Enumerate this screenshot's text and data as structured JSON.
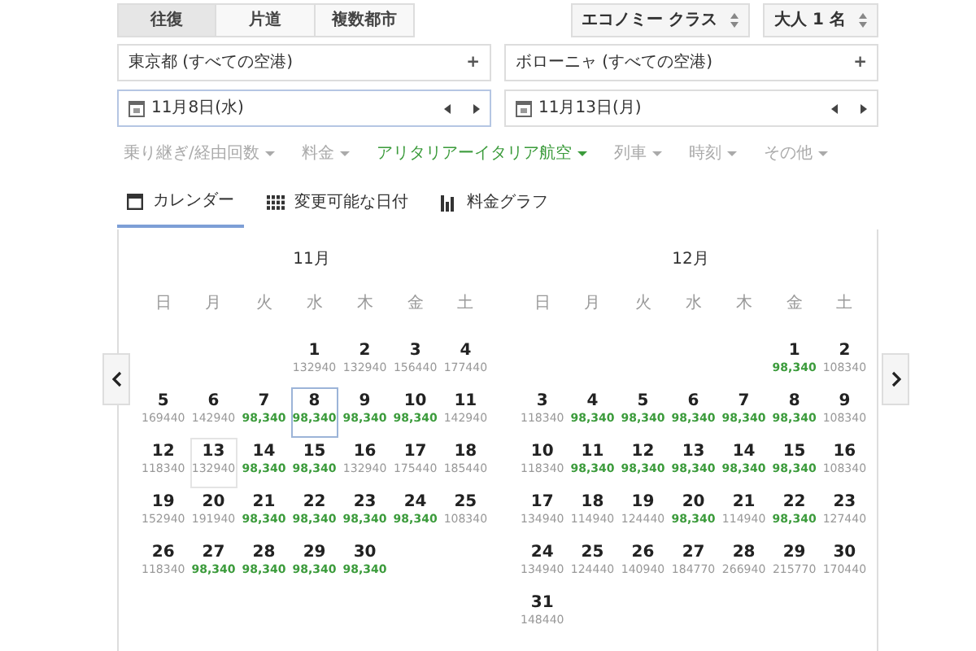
{
  "trip_types": [
    {
      "label": "往復",
      "selected": true
    },
    {
      "label": "片道",
      "selected": false
    },
    {
      "label": "複数都市",
      "selected": false
    }
  ],
  "cabin_select": {
    "value": "エコノミー クラス"
  },
  "passengers_select": {
    "value": "大人 1 名"
  },
  "origin": {
    "value": "東京都 (すべての空港)",
    "action": "+"
  },
  "destination": {
    "value": "ボローニャ (すべての空港)",
    "action": "+"
  },
  "departure_date": {
    "value": "11月8日(水)"
  },
  "return_date": {
    "value": "11月13日(月)"
  },
  "filters": [
    {
      "label": "乗り継ぎ/経由回数",
      "active": false
    },
    {
      "label": "料金",
      "active": false
    },
    {
      "label": "アリタリアーイタリア航空",
      "active": true
    },
    {
      "label": "列車",
      "active": false
    },
    {
      "label": "時刻",
      "active": false
    },
    {
      "label": "その他",
      "active": false
    }
  ],
  "view_tabs": [
    {
      "label": "カレンダー",
      "kind": "calendar",
      "selected": true
    },
    {
      "label": "変更可能な日付",
      "kind": "grid",
      "selected": false
    },
    {
      "label": "料金グラフ",
      "kind": "chart",
      "selected": false
    }
  ],
  "months": [
    {
      "title": "11月",
      "weekdays": [
        "日",
        "月",
        "火",
        "水",
        "木",
        "金",
        "土"
      ],
      "weeks": [
        [
          {
            "kind": "blank"
          },
          {
            "kind": "blank"
          },
          {
            "kind": "blank"
          },
          {
            "kind": "day",
            "day": "1",
            "price": "132940",
            "cheapest": false,
            "selected": false,
            "return_selected": false
          },
          {
            "kind": "day",
            "day": "2",
            "price": "132940",
            "cheapest": false,
            "selected": false,
            "return_selected": false
          },
          {
            "kind": "day",
            "day": "3",
            "price": "156440",
            "cheapest": false,
            "selected": false,
            "return_selected": false
          },
          {
            "kind": "day",
            "day": "4",
            "price": "177440",
            "cheapest": false,
            "selected": false,
            "return_selected": false
          }
        ],
        [
          {
            "kind": "day",
            "day": "5",
            "price": "169440",
            "cheapest": false,
            "selected": false,
            "return_selected": false
          },
          {
            "kind": "day",
            "day": "6",
            "price": "142940",
            "cheapest": false,
            "selected": false,
            "return_selected": false
          },
          {
            "kind": "day",
            "day": "7",
            "price": "98,340",
            "cheapest": true,
            "selected": false,
            "return_selected": false
          },
          {
            "kind": "day",
            "day": "8",
            "price": "98,340",
            "cheapest": true,
            "selected": true,
            "return_selected": false
          },
          {
            "kind": "day",
            "day": "9",
            "price": "98,340",
            "cheapest": true,
            "selected": false,
            "return_selected": false
          },
          {
            "kind": "day",
            "day": "10",
            "price": "98,340",
            "cheapest": true,
            "selected": false,
            "return_selected": false
          },
          {
            "kind": "day",
            "day": "11",
            "price": "142940",
            "cheapest": false,
            "selected": false,
            "return_selected": false
          }
        ],
        [
          {
            "kind": "day",
            "day": "12",
            "price": "118340",
            "cheapest": false,
            "selected": false,
            "return_selected": false
          },
          {
            "kind": "day",
            "day": "13",
            "price": "132940",
            "cheapest": false,
            "selected": false,
            "return_selected": true
          },
          {
            "kind": "day",
            "day": "14",
            "price": "98,340",
            "cheapest": true,
            "selected": false,
            "return_selected": false
          },
          {
            "kind": "day",
            "day": "15",
            "price": "98,340",
            "cheapest": true,
            "selected": false,
            "return_selected": false
          },
          {
            "kind": "day",
            "day": "16",
            "price": "132940",
            "cheapest": false,
            "selected": false,
            "return_selected": false
          },
          {
            "kind": "day",
            "day": "17",
            "price": "175440",
            "cheapest": false,
            "selected": false,
            "return_selected": false
          },
          {
            "kind": "day",
            "day": "18",
            "price": "185440",
            "cheapest": false,
            "selected": false,
            "return_selected": false
          }
        ],
        [
          {
            "kind": "day",
            "day": "19",
            "price": "152940",
            "cheapest": false,
            "selected": false,
            "return_selected": false
          },
          {
            "kind": "day",
            "day": "20",
            "price": "191940",
            "cheapest": false,
            "selected": false,
            "return_selected": false
          },
          {
            "kind": "day",
            "day": "21",
            "price": "98,340",
            "cheapest": true,
            "selected": false,
            "return_selected": false
          },
          {
            "kind": "day",
            "day": "22",
            "price": "98,340",
            "cheapest": true,
            "selected": false,
            "return_selected": false
          },
          {
            "kind": "day",
            "day": "23",
            "price": "98,340",
            "cheapest": true,
            "selected": false,
            "return_selected": false
          },
          {
            "kind": "day",
            "day": "24",
            "price": "98,340",
            "cheapest": true,
            "selected": false,
            "return_selected": false
          },
          {
            "kind": "day",
            "day": "25",
            "price": "108340",
            "cheapest": false,
            "selected": false,
            "return_selected": false
          }
        ],
        [
          {
            "kind": "day",
            "day": "26",
            "price": "118340",
            "cheapest": false,
            "selected": false,
            "return_selected": false
          },
          {
            "kind": "day",
            "day": "27",
            "price": "98,340",
            "cheapest": true,
            "selected": false,
            "return_selected": false
          },
          {
            "kind": "day",
            "day": "28",
            "price": "98,340",
            "cheapest": true,
            "selected": false,
            "return_selected": false
          },
          {
            "kind": "day",
            "day": "29",
            "price": "98,340",
            "cheapest": true,
            "selected": false,
            "return_selected": false
          },
          {
            "kind": "day",
            "day": "30",
            "price": "98,340",
            "cheapest": true,
            "selected": false,
            "return_selected": false
          }
        ]
      ]
    },
    {
      "title": "12月",
      "weekdays": [
        "日",
        "月",
        "火",
        "水",
        "木",
        "金",
        "土"
      ],
      "weeks": [
        [
          {
            "kind": "blank"
          },
          {
            "kind": "blank"
          },
          {
            "kind": "blank"
          },
          {
            "kind": "blank"
          },
          {
            "kind": "blank"
          },
          {
            "kind": "day",
            "day": "1",
            "price": "98,340",
            "cheapest": true,
            "selected": false,
            "return_selected": false
          },
          {
            "kind": "day",
            "day": "2",
            "price": "108340",
            "cheapest": false,
            "selected": false,
            "return_selected": false
          }
        ],
        [
          {
            "kind": "day",
            "day": "3",
            "price": "118340",
            "cheapest": false,
            "selected": false,
            "return_selected": false
          },
          {
            "kind": "day",
            "day": "4",
            "price": "98,340",
            "cheapest": true,
            "selected": false,
            "return_selected": false
          },
          {
            "kind": "day",
            "day": "5",
            "price": "98,340",
            "cheapest": true,
            "selected": false,
            "return_selected": false
          },
          {
            "kind": "day",
            "day": "6",
            "price": "98,340",
            "cheapest": true,
            "selected": false,
            "return_selected": false
          },
          {
            "kind": "day",
            "day": "7",
            "price": "98,340",
            "cheapest": true,
            "selected": false,
            "return_selected": false
          },
          {
            "kind": "day",
            "day": "8",
            "price": "98,340",
            "cheapest": true,
            "selected": false,
            "return_selected": false
          },
          {
            "kind": "day",
            "day": "9",
            "price": "108340",
            "cheapest": false,
            "selected": false,
            "return_selected": false
          }
        ],
        [
          {
            "kind": "day",
            "day": "10",
            "price": "118340",
            "cheapest": false,
            "selected": false,
            "return_selected": false
          },
          {
            "kind": "day",
            "day": "11",
            "price": "98,340",
            "cheapest": true,
            "selected": false,
            "return_selected": false
          },
          {
            "kind": "day",
            "day": "12",
            "price": "98,340",
            "cheapest": true,
            "selected": false,
            "return_selected": false
          },
          {
            "kind": "day",
            "day": "13",
            "price": "98,340",
            "cheapest": true,
            "selected": false,
            "return_selected": false
          },
          {
            "kind": "day",
            "day": "14",
            "price": "98,340",
            "cheapest": true,
            "selected": false,
            "return_selected": false
          },
          {
            "kind": "day",
            "day": "15",
            "price": "98,340",
            "cheapest": true,
            "selected": false,
            "return_selected": false
          },
          {
            "kind": "day",
            "day": "16",
            "price": "108340",
            "cheapest": false,
            "selected": false,
            "return_selected": false
          }
        ],
        [
          {
            "kind": "day",
            "day": "17",
            "price": "134940",
            "cheapest": false,
            "selected": false,
            "return_selected": false
          },
          {
            "kind": "day",
            "day": "18",
            "price": "114940",
            "cheapest": false,
            "selected": false,
            "return_selected": false
          },
          {
            "kind": "day",
            "day": "19",
            "price": "124440",
            "cheapest": false,
            "selected": false,
            "return_selected": false
          },
          {
            "kind": "day",
            "day": "20",
            "price": "98,340",
            "cheapest": true,
            "selected": false,
            "return_selected": false
          },
          {
            "kind": "day",
            "day": "21",
            "price": "114940",
            "cheapest": false,
            "selected": false,
            "return_selected": false
          },
          {
            "kind": "day",
            "day": "22",
            "price": "98,340",
            "cheapest": true,
            "selected": false,
            "return_selected": false
          },
          {
            "kind": "day",
            "day": "23",
            "price": "127440",
            "cheapest": false,
            "selected": false,
            "return_selected": false
          }
        ],
        [
          {
            "kind": "day",
            "day": "24",
            "price": "134940",
            "cheapest": false,
            "selected": false,
            "return_selected": false
          },
          {
            "kind": "day",
            "day": "25",
            "price": "124440",
            "cheapest": false,
            "selected": false,
            "return_selected": false
          },
          {
            "kind": "day",
            "day": "26",
            "price": "140940",
            "cheapest": false,
            "selected": false,
            "return_selected": false
          },
          {
            "kind": "day",
            "day": "27",
            "price": "184770",
            "cheapest": false,
            "selected": false,
            "return_selected": false
          },
          {
            "kind": "day",
            "day": "28",
            "price": "266940",
            "cheapest": false,
            "selected": false,
            "return_selected": false
          },
          {
            "kind": "day",
            "day": "29",
            "price": "215770",
            "cheapest": false,
            "selected": false,
            "return_selected": false
          },
          {
            "kind": "day",
            "day": "30",
            "price": "170440",
            "cheapest": false,
            "selected": false,
            "return_selected": false
          }
        ],
        [
          {
            "kind": "day",
            "day": "31",
            "price": "148440",
            "cheapest": false,
            "selected": false,
            "return_selected": false
          }
        ]
      ]
    }
  ]
}
